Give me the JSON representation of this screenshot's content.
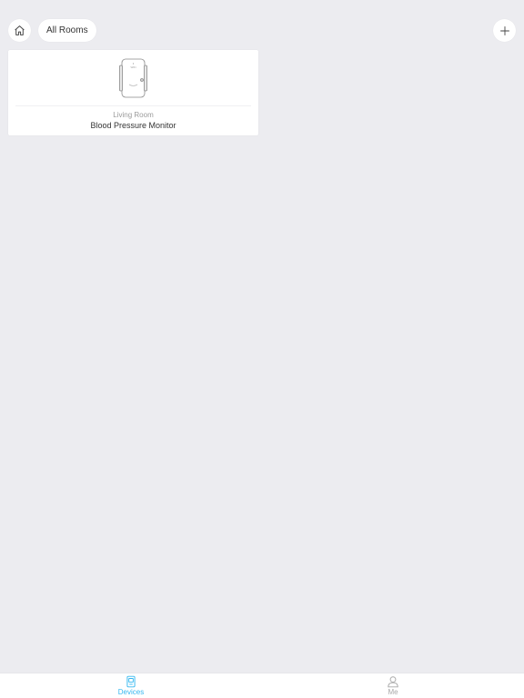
{
  "header": {
    "home_icon": "home-icon",
    "room_filter_label": "All Rooms",
    "add_icon": "plus-icon"
  },
  "devices": [
    {
      "room": "Living Room",
      "name": "Blood Pressure Monitor",
      "image": "blood-pressure-monitor-image"
    }
  ],
  "tab_bar": {
    "tabs": [
      {
        "label": "Devices",
        "icon": "devices-icon",
        "active": true
      },
      {
        "label": "Me",
        "icon": "person-icon",
        "active": false
      }
    ],
    "active_color": "#35b8f0",
    "inactive_color": "#a8a8a8"
  },
  "colors": {
    "background": "#ececf0",
    "card": "#ffffff"
  }
}
